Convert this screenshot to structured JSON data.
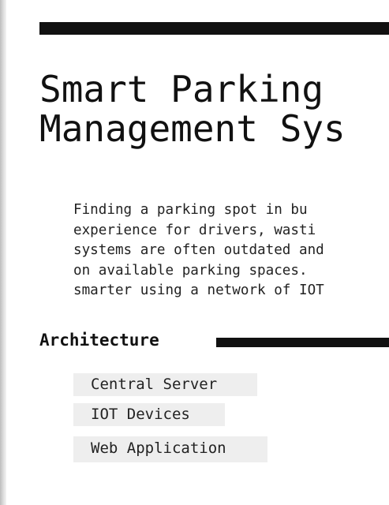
{
  "document": {
    "title_lines": [
      "Smart Parking",
      "Management Sys"
    ],
    "intro_lines": [
      "Finding a parking spot in bu",
      "experience for drivers, wasti",
      "systems are often outdated and",
      "on available parking spaces.",
      "smarter using a network of IOT"
    ],
    "section": {
      "title": "Architecture",
      "components": [
        "Central Server",
        "IOT Devices",
        "Web Application"
      ]
    }
  },
  "colors": {
    "ink": "#111111",
    "chip_background": "#eeeeee",
    "page_background": "#ffffff"
  }
}
